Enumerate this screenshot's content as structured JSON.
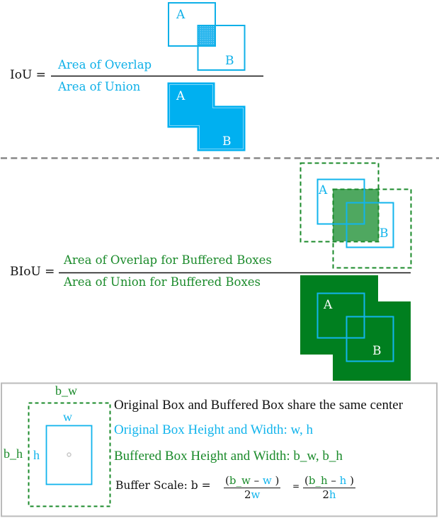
{
  "colors": {
    "blue": "#0fb0e8",
    "blue_fill": "#00b0f0",
    "green": "#1a8a2a",
    "green_fill": "#007f1f",
    "green_overlap": "#4fa860",
    "divider": "#888888",
    "legend_border": "#bbbbbb",
    "text": "#111111"
  },
  "iou": {
    "lhs": "IoU =",
    "numerator": "Area of Overlap",
    "denominator": "Area of Union",
    "overlap_fig": {
      "box_a_label": "A",
      "box_b_label": "B"
    },
    "union_fig": {
      "box_a_label": "A",
      "box_b_label": "B"
    }
  },
  "biou": {
    "lhs": "BIoU =",
    "numerator": "Area of Overlap for Buffered Boxes",
    "denominator": "Area of Union for Buffered Boxes",
    "overlap_fig": {
      "box_a_label": "A",
      "box_b_label": "B"
    },
    "union_fig": {
      "box_a_label": "A",
      "box_b_label": "B"
    }
  },
  "legend": {
    "buffered_width_label": "b_w",
    "buffered_height_label": "b_h",
    "original_width_label": "w",
    "original_height_label": "h",
    "line1": "Original Box and Buffered Box share the same center",
    "line2": "Original Box Height and Width: w, h",
    "line3": "Buffered Box Height and Width: b_w, b_h",
    "formula": {
      "prefix": "Buffer Scale: b =",
      "frac1_num_open": "(",
      "frac1_num_bw": "b_w",
      "frac1_num_minus": " – ",
      "frac1_num_w": "w",
      "frac1_num_close": " )",
      "frac1_den_2": "2",
      "frac1_den_w": "w",
      "equals": "=",
      "frac2_num_open": "(",
      "frac2_num_bh": "b_h",
      "frac2_num_minus": " – ",
      "frac2_num_h": "h",
      "frac2_num_close": " )",
      "frac2_den_2": "2",
      "frac2_den_h": "h"
    }
  }
}
